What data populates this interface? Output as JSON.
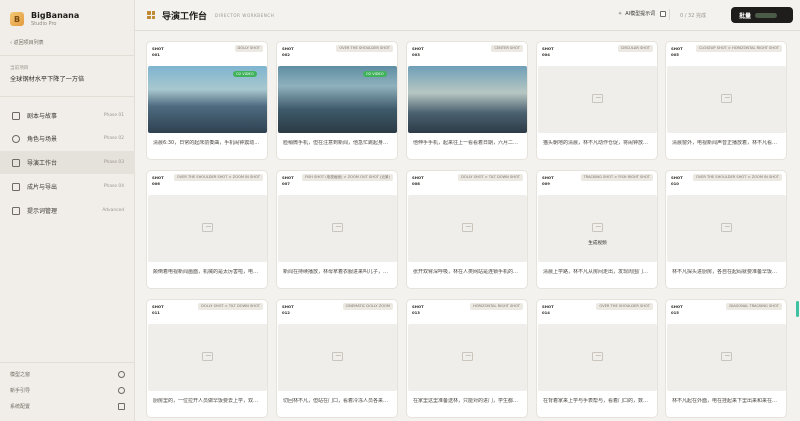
{
  "brand": {
    "name": "BigBanana",
    "subtitle": "Studio Pro",
    "logo_letter": "B"
  },
  "sidebar": {
    "back_label": "返回项目列表",
    "project_label": "当前项目",
    "project_name": "全球钢材水平下降了一万倍",
    "items": [
      {
        "label": "剧本与故事",
        "phase": "Phase 01",
        "icon": "document-icon",
        "active": false
      },
      {
        "label": "角色与场景",
        "phase": "Phase 02",
        "icon": "users-icon",
        "active": false
      },
      {
        "label": "导演工作台",
        "phase": "Phase 03",
        "icon": "clapper-icon",
        "active": true
      },
      {
        "label": "成片与导出",
        "phase": "Phase 04",
        "icon": "film-icon",
        "active": false
      },
      {
        "label": "提示词管理",
        "phase": "Advanced",
        "icon": "sliders-icon",
        "active": false
      }
    ],
    "footer": [
      {
        "label": "模型之窗",
        "icon": "help-icon"
      },
      {
        "label": "新手引导",
        "icon": "moon-icon"
      },
      {
        "label": "系统配置",
        "icon": "settings-icon"
      }
    ]
  },
  "header": {
    "title": "导演工作台",
    "subtitle": "DIRECTOR WORKBENCH",
    "ai_label": "AI模型提示词",
    "progress": "0 / 32 完成",
    "export_label": "批量"
  },
  "cards": [
    {
      "num": "SHOT 001",
      "type": "DOLLY SHOT",
      "desc": "清晨6:30，日常的起床前奏曲，手机闹钟震动，窗外阳光温柔",
      "has_image": true,
      "badge": "O2 VIDEO"
    },
    {
      "num": "SHOT 002",
      "type": "OVER THE SHOULDER SHOT",
      "desc": "脸稍微手机，但在注意到新闻，他急忙跳起身来一样全国的一切不对，比如",
      "has_image": true,
      "badge": "O2 VIDEO"
    },
    {
      "num": "SHOT 003",
      "type": "CENTER SHOT",
      "desc": "他伸手手机，起来往上一看看着日期，六月二日，不是那人们，猫也是一些",
      "has_image": true,
      "badge": ""
    },
    {
      "num": "SHOT 004",
      "type": "CIRCULAR SHOT",
      "desc": "猫头朝地的清晨，林不凡动作仓促，将闹钟放到最前面，就整好的",
      "has_image": false,
      "badge": ""
    },
    {
      "num": "SHOT 005",
      "type": "CLOSEUP SHOT > HORIZONTAL RIGHT SHOT",
      "desc": "清晨窗外，电视新闻声音正播放着，林不凡看着日期数据，门口来",
      "has_image": false,
      "badge": ""
    },
    {
      "num": "SHOT 006",
      "type": "OVER THE SHOULDER SHOT > ZOOM IN SHOT",
      "desc": "颠倒着电视新闻画面，机械的是太厉害啦，电子邮件和资讯等原因",
      "has_image": false,
      "badge": ""
    },
    {
      "num": "SHOT 007",
      "type": "FISH SHOT (电视画面) > ZOOM OUT SHOT (近景)",
      "desc": "新闻在持续播放，林母拿着衣服进来叫儿子，该你了",
      "has_image": false,
      "badge": ""
    },
    {
      "num": "SHOT 008",
      "type": "DOLLY SHOT > TILT DOWN SHOT",
      "desc": "张开双臂深呼吸，林在人类网站是连锁手机的下载，并在积极的数字化",
      "has_image": false,
      "badge": ""
    },
    {
      "num": "SHOT 009",
      "type": "TRACKING SHOT > FISH RIGHT SHOT",
      "desc": "清晨上学路，林不凡从房间走出，发现周围门口的设置都是",
      "has_image": false,
      "badge": "",
      "overlay": "生成视频"
    },
    {
      "num": "SHOT 010",
      "type": "OVER THE SHOULDER SHOT > ZOOM IN SHOT",
      "desc": "林不凡探头进厨房，各自在起码就要准备早饭的东西",
      "has_image": false,
      "badge": ""
    },
    {
      "num": "SHOT 011",
      "type": "DOLLY SHOT > TILT DOWN SHOT",
      "desc": "厨房里的，一位拉开人员做早饭要去上学，双手拿起锅盖",
      "has_image": false,
      "badge": ""
    },
    {
      "num": "SHOT 012",
      "type": "CINEMATIC DOLLY ZOOM",
      "desc": "切回林不凡，但站在门口，看着冷冻人员各来回是那好的",
      "has_image": false,
      "badge": ""
    },
    {
      "num": "SHOT 013",
      "type": "HORIZONTAL RIGHT SHOT",
      "desc": "在家里这里准备送林，只能对的进门，学生都在快进最开心的的",
      "has_image": false,
      "badge": ""
    },
    {
      "num": "SHOT 014",
      "type": "OVER THE SHOULDER SHOT",
      "desc": "在背着家来上学与手表帮与，看着门口的，数据表本能地在电子",
      "has_image": false,
      "badge": ""
    },
    {
      "num": "SHOT 015",
      "type": "DIAGONAL TRACKING SHOT",
      "desc": "林不凡起在外面，电在挂起来下里出来和来在门口，钢铁的厚度",
      "has_image": false,
      "badge": ""
    }
  ]
}
